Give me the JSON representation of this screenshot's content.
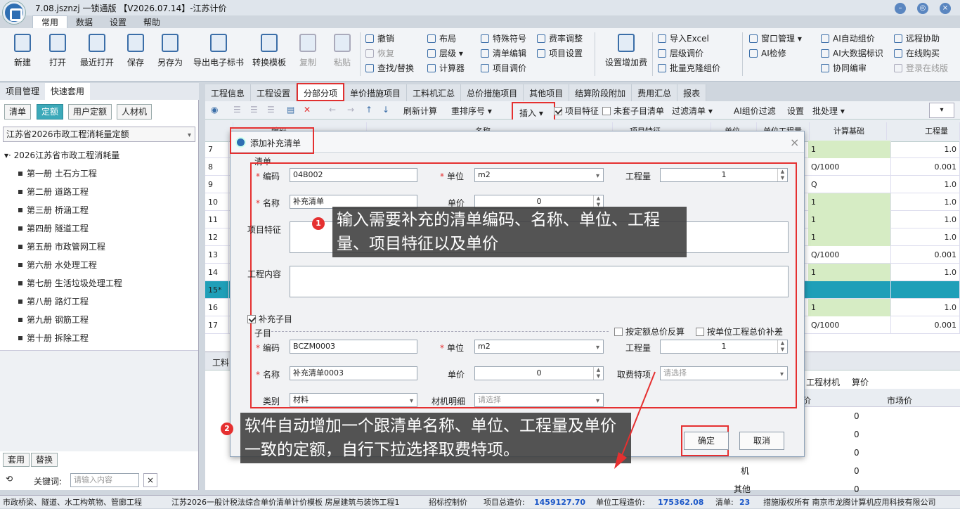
{
  "window": {
    "title": "7.08.jsznzj 一锁通版 【V2026.07.14】-江苏计价"
  },
  "menu": {
    "items": [
      "常用",
      "数据",
      "设置",
      "帮助"
    ]
  },
  "ribbon": {
    "big": [
      "新建",
      "打开",
      "最近打开",
      "保存",
      "另存为",
      "导出电子标书",
      "转换模板",
      "复制",
      "粘贴"
    ],
    "edit": [
      "撤销",
      "恢复",
      "查找/替换"
    ],
    "layout": [
      "布局",
      "层级",
      "计算器"
    ],
    "special": [
      "特殊符号",
      "清单编辑",
      "项目调价"
    ],
    "rate": [
      "费率调整",
      "项目设置"
    ],
    "fee": "设置增加费",
    "import": [
      "导入Excel",
      "层级调价",
      "批量克隆组价"
    ],
    "window": [
      "窗口管理",
      "AI检修"
    ],
    "ai": [
      "AI自动组价",
      "AI大数据标识",
      "协同编审"
    ],
    "remote": [
      "远程协助",
      "在线购买",
      "登录在线版"
    ]
  },
  "left": {
    "tabs": [
      "项目管理",
      "快速套用"
    ],
    "buttons": [
      "清单",
      "定额",
      "用户定额",
      "人材机"
    ],
    "quota_select": "江苏省2026市政工程消耗量定额",
    "tree_root": "2026江苏省市政工程消耗量",
    "tree": [
      "第一册 土石方工程",
      "第二册 道路工程",
      "第三册 桥涵工程",
      "第四册 隧道工程",
      "第五册 市政管网工程",
      "第六册 水处理工程",
      "第七册 生活垃圾处理工程",
      "第八册 路灯工程",
      "第九册 钢筋工程",
      "第十册 拆除工程"
    ],
    "apply": "套用",
    "replace": "替换",
    "keyword_label": "关键词:",
    "keyword_placeholder": "请输入内容"
  },
  "main": {
    "tabs": [
      "工程信息",
      "工程设置",
      "分部分项",
      "单价措施项目",
      "工料机汇总",
      "总价措施项目",
      "其他项目",
      "结算阶段附加",
      "费用汇总",
      "报表"
    ],
    "toolbar": [
      "刷新计算",
      "重排序号",
      "插入",
      "项目特征",
      "未套子目清单",
      "过滤清单",
      "AI组价过滤",
      "设置",
      "批处理"
    ],
    "columns": [
      "",
      "编码",
      "名称",
      "项目特征",
      "单位",
      "单位工程量",
      "计算基础",
      "工程量"
    ],
    "rows": [
      {
        "n": "7",
        "base": "1",
        "qty": "1.0"
      },
      {
        "n": "8",
        "base": "Q/1000",
        "qty": "0.001"
      },
      {
        "n": "9",
        "base": "Q",
        "qty": "1.0"
      },
      {
        "n": "10",
        "base": "1",
        "qty": "1.0"
      },
      {
        "n": "11",
        "base": "1",
        "qty": "1.0"
      },
      {
        "n": "12",
        "base": "1",
        "qty": "1.0"
      },
      {
        "n": "13",
        "base": "Q/1000",
        "qty": "0.001"
      },
      {
        "n": "14",
        "base": "1",
        "qty": "1.0"
      },
      {
        "n": "15*",
        "base": "",
        "qty": ""
      },
      {
        "n": "16",
        "base": "1",
        "qty": "1.0"
      },
      {
        "n": "17",
        "base": "Q/1000",
        "qty": "0.001"
      }
    ],
    "bottom_tabs": [
      "工料",
      "工程材机",
      "算价"
    ],
    "bottom_cols": [
      "价",
      "市场价"
    ],
    "bottom_vals": [
      "0",
      "0",
      "0",
      "0",
      "0"
    ],
    "bottom_labels": [
      "机",
      "其他"
    ]
  },
  "dialog": {
    "title": "添加补充清单",
    "section_bill": "清单",
    "code_label": "编码",
    "code_value": "04B002",
    "unit_label": "单位",
    "unit_value": "m2",
    "qty_label": "工程量",
    "qty_value": "1",
    "name_label": "名称",
    "name_value": "补充清单",
    "price_label": "单价",
    "price_value": "0",
    "feature_label": "项目特征",
    "content_label": "工程内容",
    "add_sub_label": "补充子目",
    "section_sub": "子目",
    "reverse_label": "按定额总价反算",
    "diff_label": "按单位工程总价补差",
    "sub_code_value": "BCZM0003",
    "sub_unit_value": "m2",
    "sub_qty_value": "1",
    "sub_name_value": "补充清单0003",
    "sub_price_value": "0",
    "fee_label": "取费特项",
    "fee_placeholder": "请选择",
    "category_label": "类别",
    "category_value": "材料",
    "material_label": "材机明细",
    "material_placeholder": "请选择",
    "ok": "确定",
    "cancel": "取消"
  },
  "callouts": {
    "one_num": "1",
    "one_text": "输入需要补充的清单编码、名称、单位、工程量、项目特征以及单价",
    "two_num": "2",
    "two_text": "软件自动增加一个跟清单名称、单位、工程量及单价一致的定额，自行下拉选择取费特项。"
  },
  "status": {
    "scope": "市政桥梁、隧道、水工构筑物、管廊工程",
    "template": "江苏2026一般计税法综合单价清单计价模板 房屋建筑与装饰工程1",
    "control": "招标控制价",
    "total_label": "项目总造价:",
    "total_value": "1459127.70",
    "unit_label": "单位工程造价:",
    "unit_value": "175362.08",
    "bill_label": "清单:",
    "bill_value": "23",
    "rights": "措施版权所有 南京市龙腾计算机应用科技有限公司"
  },
  "colors": {
    "accent": "#3ca9b9",
    "highlight": "#e53030",
    "green_cell": "#d6ecc4",
    "teal_row": "#1f9fb8"
  }
}
